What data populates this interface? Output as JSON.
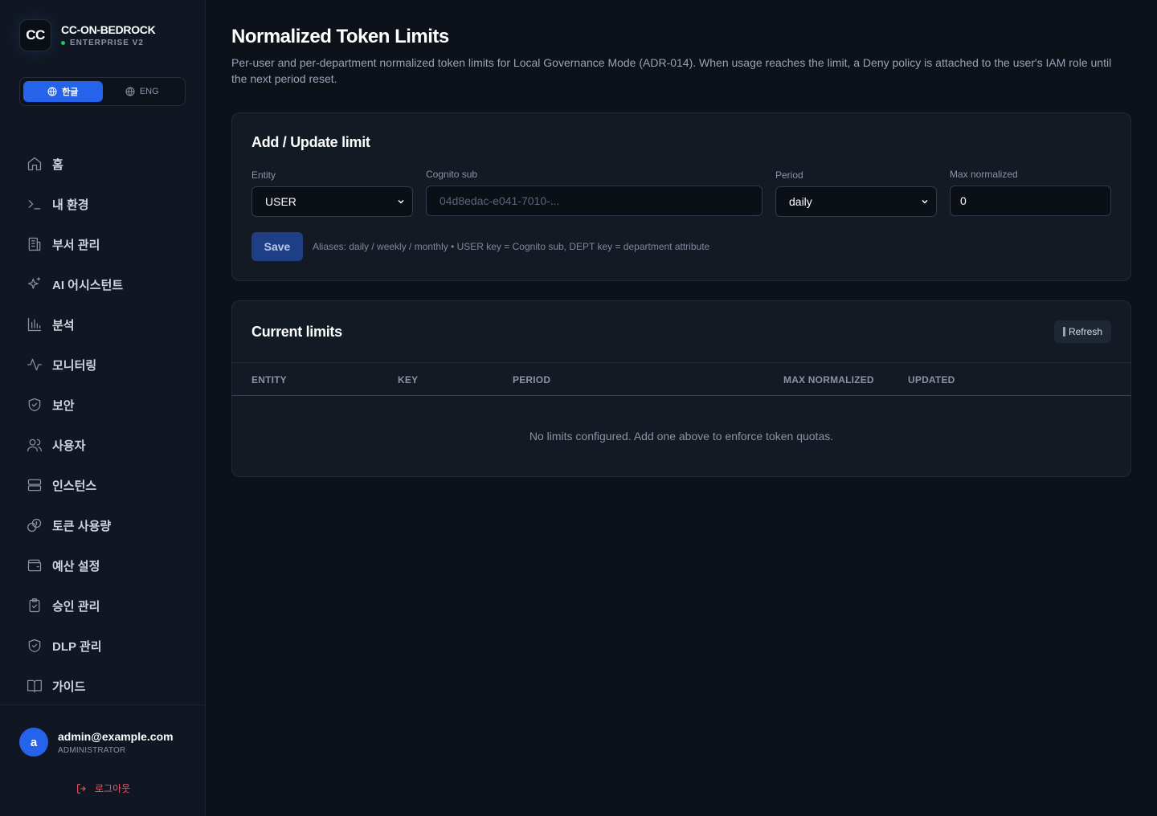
{
  "brand": {
    "logo": "CC",
    "name": "CC-ON-BEDROCK",
    "subtitle": "ENTERPRISE V2",
    "status_color": "#22c55e"
  },
  "language": {
    "korean": "한글",
    "english": "ENG",
    "active": "korean"
  },
  "nav": [
    {
      "label": "홈",
      "icon": "home-icon"
    },
    {
      "label": "내 환경",
      "icon": "terminal-icon"
    },
    {
      "label": "부서 관리",
      "icon": "building-icon"
    },
    {
      "label": "AI 어시스턴트",
      "icon": "sparkles-icon"
    },
    {
      "label": "분석",
      "icon": "bar-chart-icon"
    },
    {
      "label": "모니터링",
      "icon": "activity-icon"
    },
    {
      "label": "보안",
      "icon": "shield-check-icon"
    },
    {
      "label": "사용자",
      "icon": "users-icon"
    },
    {
      "label": "인스턴스",
      "icon": "server-icon"
    },
    {
      "label": "토큰 사용량",
      "icon": "coins-icon"
    },
    {
      "label": "예산 설정",
      "icon": "wallet-icon"
    },
    {
      "label": "승인 관리",
      "icon": "clipboard-check-icon"
    },
    {
      "label": "DLP 관리",
      "icon": "shield-check-icon"
    },
    {
      "label": "가이드",
      "icon": "book-icon"
    }
  ],
  "user": {
    "initial": "a",
    "email": "admin@example.com",
    "role": "ADMINISTRATOR",
    "logout": "로그아웃"
  },
  "page": {
    "title": "Normalized Token Limits",
    "description": "Per-user and per-department normalized token limits for Local Governance Mode (ADR-014). When usage reaches the limit, a Deny policy is attached to the user's IAM role until the next period reset."
  },
  "form": {
    "title": "Add / Update limit",
    "entity_label": "Entity",
    "entity_value": "USER",
    "cognito_label": "Cognito sub",
    "cognito_placeholder": "04d8edac-e041-7010-...",
    "period_label": "Period",
    "period_value": "daily",
    "max_label": "Max normalized",
    "max_value": "0",
    "save": "Save",
    "hint": "Aliases: daily / weekly / monthly • USER key = Cognito sub, DEPT key = department attribute"
  },
  "table": {
    "title": "Current limits",
    "refresh": "Refresh",
    "columns": [
      "ENTITY",
      "KEY",
      "PERIOD",
      "MAX NORMALIZED",
      "UPDATED"
    ],
    "empty": "No limits configured. Add one above to enforce token quotas."
  },
  "colors": {
    "accent": "#2563eb",
    "logout": "#f05565",
    "background": "#0c111a",
    "card": "#141a24"
  }
}
